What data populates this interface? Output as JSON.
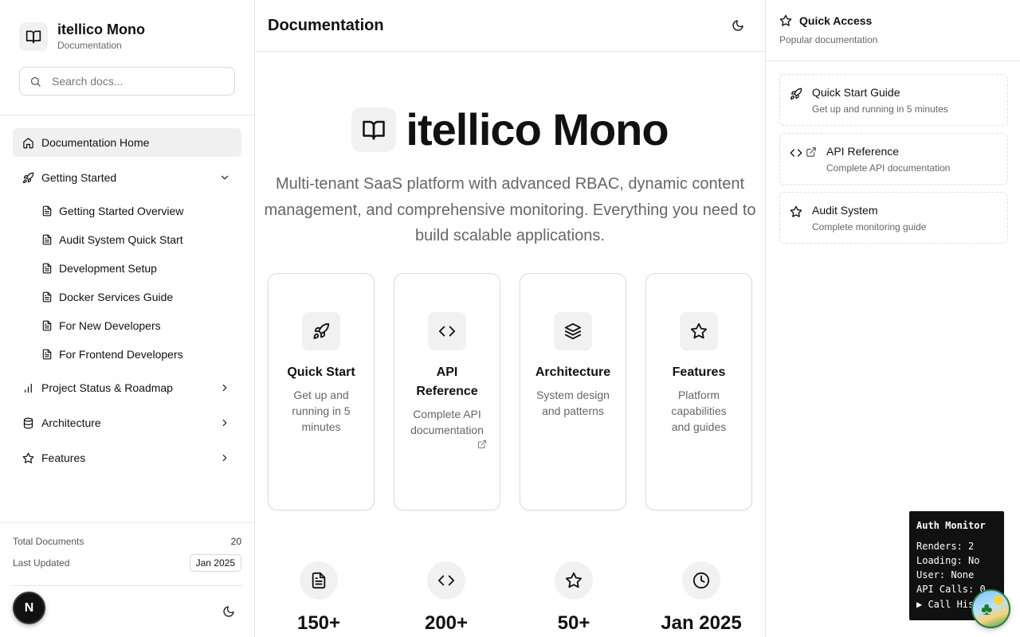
{
  "sidebar": {
    "brand_title": "itellico Mono",
    "brand_subtitle": "Documentation",
    "search_placeholder": "Search docs...",
    "home_label": "Documentation Home",
    "getting_started": {
      "label": "Getting Started",
      "items": [
        "Getting Started Overview",
        "Audit System Quick Start",
        "Development Setup",
        "Docker Services Guide",
        "For New Developers",
        "For Frontend Developers"
      ]
    },
    "sections": [
      {
        "label": "Project Status & Roadmap",
        "icon": "bar-chart-icon"
      },
      {
        "label": "Architecture",
        "icon": "database-icon"
      },
      {
        "label": "Features",
        "icon": "star-icon"
      }
    ],
    "stats": {
      "total_docs_label": "Total Documents",
      "total_docs_value": "20",
      "last_updated_label": "Last Updated",
      "last_updated_value": "Jan 2025"
    },
    "fab_letter": "N"
  },
  "main": {
    "page_title": "Documentation",
    "hero": {
      "title": "itellico Mono",
      "description": "Multi-tenant SaaS platform with advanced RBAC, dynamic content management, and comprehensive monitoring. Everything you need to build scalable applications."
    },
    "cards": [
      {
        "title": "Quick Start",
        "desc": "Get up and running in 5 minutes",
        "icon": "rocket-icon"
      },
      {
        "title": "API Reference",
        "desc": "Complete API documentation",
        "icon": "code-icon"
      },
      {
        "title": "Architecture",
        "desc": "System design and patterns",
        "icon": "layers-icon"
      },
      {
        "title": "Features",
        "desc": "Platform capabilities and guides",
        "icon": "star-icon"
      }
    ],
    "stats": [
      {
        "value": "150+",
        "icon": "file-text-icon"
      },
      {
        "value": "200+",
        "icon": "code-icon"
      },
      {
        "value": "50+",
        "icon": "star-icon"
      },
      {
        "value": "Jan 2025",
        "icon": "clock-icon"
      }
    ]
  },
  "quick_access": {
    "title": "Quick Access",
    "subtitle": "Popular documentation",
    "items": [
      {
        "title": "Quick Start Guide",
        "desc": "Get up and running in 5 minutes",
        "icon": "rocket-icon"
      },
      {
        "title": "API Reference",
        "desc": "Complete API documentation",
        "icon": "code-icon"
      },
      {
        "title": "Audit System",
        "desc": "Complete monitoring guide",
        "icon": "star-icon"
      }
    ]
  },
  "auth_monitor": {
    "title": "Auth Monitor",
    "renders": "Renders: 2",
    "loading": "Loading: No",
    "user": "User: None",
    "api_calls": "API Calls: 0",
    "call_history": "▶ Call History"
  }
}
